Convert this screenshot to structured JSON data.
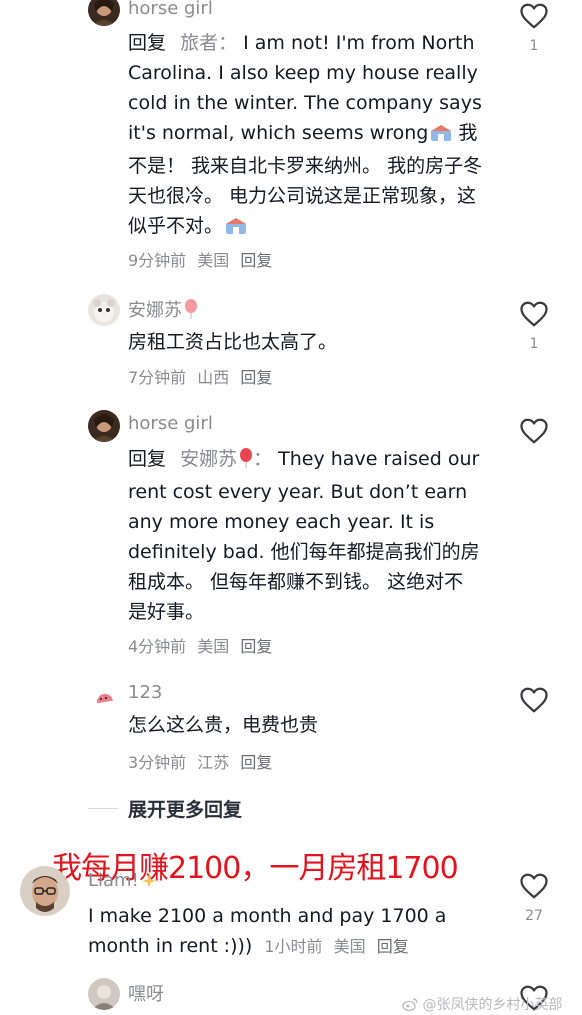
{
  "comments": [
    {
      "username": "horse girl",
      "reply_word": "回复",
      "reply_target": "旅者：",
      "text": "I am not! I'm from North Carolina. I also keep my house really cold in the winter. The company says it's normal, which seems wrong",
      "text_cn": "我不是！ 我来自北卡罗来纳州。 我的房子冬天也很冷。 电力公司说这是正常现象，这似乎不对。",
      "time": "9分钟前",
      "location": "美国",
      "reply_label": "回复",
      "likes": "1"
    },
    {
      "username": "安娜苏",
      "text": "房租工资占比也太高了。",
      "time": "7分钟前",
      "location": "山西",
      "reply_label": "回复",
      "likes": "1"
    },
    {
      "username": "horse girl",
      "reply_word": "回复",
      "reply_target": "安娜苏",
      "reply_colon": "：",
      "text": "They have raised our rent cost every year. But don’t earn any more money each year. It is definitely bad.  他们每年都提高我们的房租成本。 但每年都赚不到钱。 这绝对不是好事。",
      "time": "4分钟前",
      "location": "美国",
      "reply_label": "回复"
    },
    {
      "username": "123",
      "text": "怎么这么贵，电费也贵",
      "time": "3分钟前",
      "location": "江苏",
      "reply_label": "回复"
    }
  ],
  "expand_label": "展开更多回复",
  "overlay_caption": "我每月赚2100，一月房租1700",
  "top_comment": {
    "username": "Liam!",
    "text": "I make 2100 a month and pay 1700 a month in rent :)))",
    "time": "1小时前",
    "location": "美国",
    "reply_label": "回复",
    "likes": "27"
  },
  "partial_comment": {
    "username": "嘿呀"
  },
  "watermark": "@张凤侠的乡村小英部",
  "colors": {
    "text": "#161823",
    "muted": "#8a8b91",
    "overlay_red": "#e0141e"
  }
}
